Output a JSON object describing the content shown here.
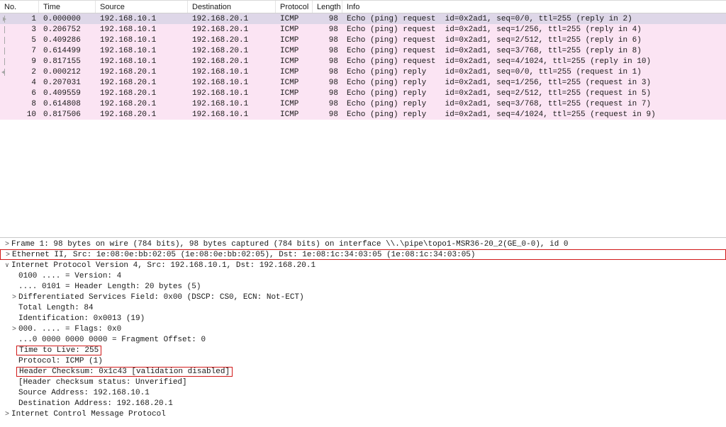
{
  "columns": {
    "no": "No.",
    "time": "Time",
    "source": "Source",
    "destination": "Destination",
    "protocol": "Protocol",
    "length": "Length",
    "info": "Info"
  },
  "packets": [
    {
      "marker": "out",
      "selected": true,
      "no": "1",
      "time": "0.000000",
      "src": "192.168.10.1",
      "dst": "192.168.20.1",
      "proto": "ICMP",
      "len": "98",
      "info": "Echo (ping) request  id=0x2ad1, seq=0/0, ttl=255 (reply in 2)"
    },
    {
      "marker": "line",
      "no": "3",
      "time": "0.206752",
      "src": "192.168.10.1",
      "dst": "192.168.20.1",
      "proto": "ICMP",
      "len": "98",
      "info": "Echo (ping) request  id=0x2ad1, seq=1/256, ttl=255 (reply in 4)"
    },
    {
      "marker": "line",
      "no": "5",
      "time": "0.409286",
      "src": "192.168.10.1",
      "dst": "192.168.20.1",
      "proto": "ICMP",
      "len": "98",
      "info": "Echo (ping) request  id=0x2ad1, seq=2/512, ttl=255 (reply in 6)"
    },
    {
      "marker": "line",
      "no": "7",
      "time": "0.614499",
      "src": "192.168.10.1",
      "dst": "192.168.20.1",
      "proto": "ICMP",
      "len": "98",
      "info": "Echo (ping) request  id=0x2ad1, seq=3/768, ttl=255 (reply in 8)"
    },
    {
      "marker": "line",
      "no": "9",
      "time": "0.817155",
      "src": "192.168.10.1",
      "dst": "192.168.20.1",
      "proto": "ICMP",
      "len": "98",
      "info": "Echo (ping) request  id=0x2ad1, seq=4/1024, ttl=255 (reply in 10)"
    },
    {
      "marker": "in",
      "no": "2",
      "time": "0.000212",
      "src": "192.168.20.1",
      "dst": "192.168.10.1",
      "proto": "ICMP",
      "len": "98",
      "info": "Echo (ping) reply    id=0x2ad1, seq=0/0, ttl=255 (request in 1)"
    },
    {
      "marker": "",
      "no": "4",
      "time": "0.207031",
      "src": "192.168.20.1",
      "dst": "192.168.10.1",
      "proto": "ICMP",
      "len": "98",
      "info": "Echo (ping) reply    id=0x2ad1, seq=1/256, ttl=255 (request in 3)"
    },
    {
      "marker": "",
      "no": "6",
      "time": "0.409559",
      "src": "192.168.20.1",
      "dst": "192.168.10.1",
      "proto": "ICMP",
      "len": "98",
      "info": "Echo (ping) reply    id=0x2ad1, seq=2/512, ttl=255 (request in 5)"
    },
    {
      "marker": "",
      "no": "8",
      "time": "0.614808",
      "src": "192.168.20.1",
      "dst": "192.168.10.1",
      "proto": "ICMP",
      "len": "98",
      "info": "Echo (ping) reply    id=0x2ad1, seq=3/768, ttl=255 (request in 7)"
    },
    {
      "marker": "",
      "no": "10",
      "time": "0.817506",
      "src": "192.168.20.1",
      "dst": "192.168.10.1",
      "proto": "ICMP",
      "len": "98",
      "info": "Echo (ping) reply    id=0x2ad1, seq=4/1024, ttl=255 (request in 9)"
    }
  ],
  "details": {
    "frame": "Frame 1: 98 bytes on wire (784 bits), 98 bytes captured (784 bits) on interface \\\\.\\pipe\\topo1-MSR36-20_2(GE_0-0), id 0",
    "ethernet": "Ethernet II, Src: 1e:08:0e:bb:02:05 (1e:08:0e:bb:02:05), Dst: 1e:08:1c:34:03:05 (1e:08:1c:34:03:05)",
    "ip_header": "Internet Protocol Version 4, Src: 192.168.10.1, Dst: 192.168.20.1",
    "ip": {
      "version": "0100 .... = Version: 4",
      "hdrlen": ".... 0101 = Header Length: 20 bytes (5)",
      "dsf": "Differentiated Services Field: 0x00 (DSCP: CS0, ECN: Not-ECT)",
      "totallen": "Total Length: 84",
      "ident": "Identification: 0x0013 (19)",
      "flags": "000. .... = Flags: 0x0",
      "fragoff": "...0 0000 0000 0000 = Fragment Offset: 0",
      "ttl": "Time to Live: 255",
      "protocol": "Protocol: ICMP (1)",
      "checksum": "Header Checksum: 0x1c43 [validation disabled]",
      "chkstatus": "[Header checksum status: Unverified]",
      "srcaddr": "Source Address: 192.168.10.1",
      "dstaddr": "Destination Address: 192.168.20.1"
    },
    "icmp": "Internet Control Message Protocol"
  }
}
